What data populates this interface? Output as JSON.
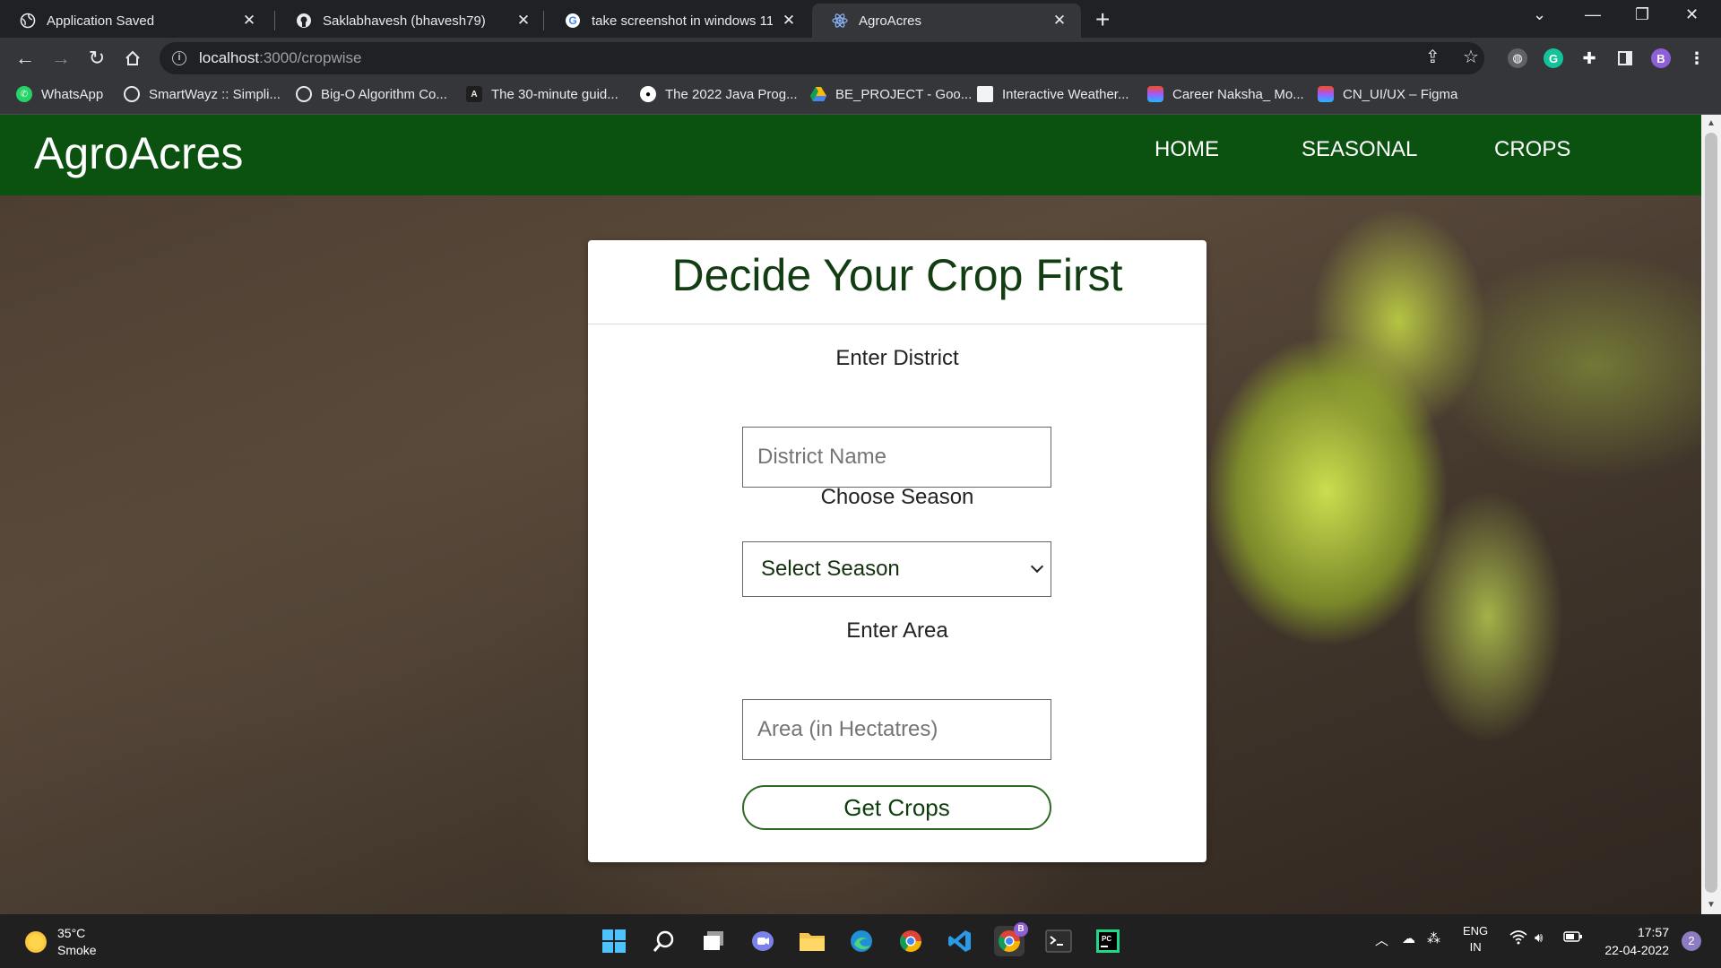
{
  "browser": {
    "tabs": [
      {
        "title": "Application Saved",
        "icon": "globe-icon",
        "active": false
      },
      {
        "title": "Saklabhavesh (bhavesh79)",
        "icon": "github-icon",
        "active": false
      },
      {
        "title": "take screenshot in windows 11 -",
        "icon": "google-icon",
        "active": false
      },
      {
        "title": "AgroAcres",
        "icon": "react-icon",
        "active": true
      }
    ],
    "address": {
      "host": "localhost",
      "path": ":3000/cropwise"
    },
    "profile_initial": "B",
    "bookmarks": [
      {
        "label": "WhatsApp",
        "icon": "whatsapp-icon"
      },
      {
        "label": "SmartWayz :: Simpli...",
        "icon": "globe-icon"
      },
      {
        "label": "Big-O Algorithm Co...",
        "icon": "globe-icon"
      },
      {
        "label": "The 30-minute guid...",
        "icon": "a-icon"
      },
      {
        "label": "The 2022 Java Prog...",
        "icon": "medium-icon"
      },
      {
        "label": "BE_PROJECT - Goo...",
        "icon": "drive-icon"
      },
      {
        "label": "Interactive Weather...",
        "icon": "page-icon"
      },
      {
        "label": "Career Naksha_ Mo...",
        "icon": "figma-icon"
      },
      {
        "label": "CN_UI/UX – Figma",
        "icon": "figma-icon"
      }
    ]
  },
  "page": {
    "brand": "AgroAcres",
    "nav": [
      "HOME",
      "SEASONAL",
      "CROPS"
    ],
    "form": {
      "title": "Decide Your Crop First",
      "district_label": "Enter District",
      "district_placeholder": "District Name",
      "season_label": "Choose Season",
      "season_selected": "Select Season",
      "area_label": "Enter Area",
      "area_placeholder": "Area (in Hectatres)",
      "submit_label": "Get Crops"
    },
    "colors": {
      "navbar": "#0b5210",
      "title": "#123c12"
    }
  },
  "taskbar": {
    "weather": {
      "temp": "35°C",
      "condition": "Smoke"
    },
    "language": [
      "ENG",
      "IN"
    ],
    "time": "17:57",
    "date": "22-04-2022",
    "notifications": "2",
    "chrome_badge": "B"
  }
}
